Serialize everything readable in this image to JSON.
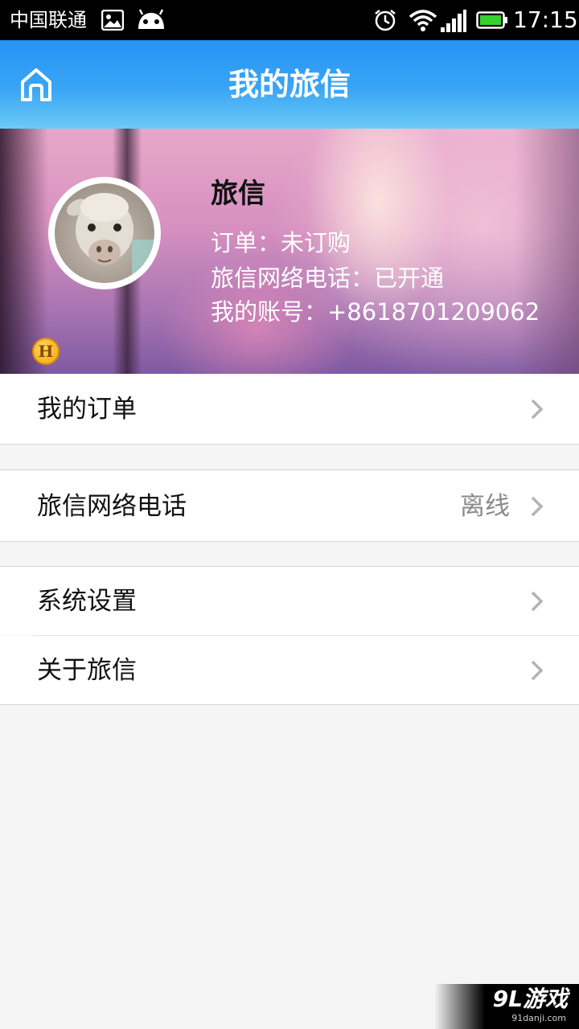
{
  "status_bar": {
    "carrier": "中国联通",
    "time": "17:15",
    "icons": [
      "gallery-icon",
      "android-icon",
      "alarm-icon",
      "wifi-icon",
      "signal-icon",
      "battery-icon"
    ]
  },
  "header": {
    "title": "我的旅信",
    "home_icon": "home-icon",
    "accent_color": "#2594f5"
  },
  "profile": {
    "name": "旅信",
    "order_status": "订单：未订购",
    "phone_status": "旅信网络电话：已开通",
    "account": "我的账号：+8618701209062",
    "badge": "H"
  },
  "menu": {
    "orders": {
      "label": "我的订单",
      "value": ""
    },
    "phone": {
      "label": "旅信网络电话",
      "value": "离线"
    },
    "settings": {
      "label": "系统设置",
      "value": ""
    },
    "about": {
      "label": "关于旅信",
      "value": ""
    }
  },
  "watermark": {
    "brand": "9L游戏",
    "domain": "91danji.com"
  }
}
